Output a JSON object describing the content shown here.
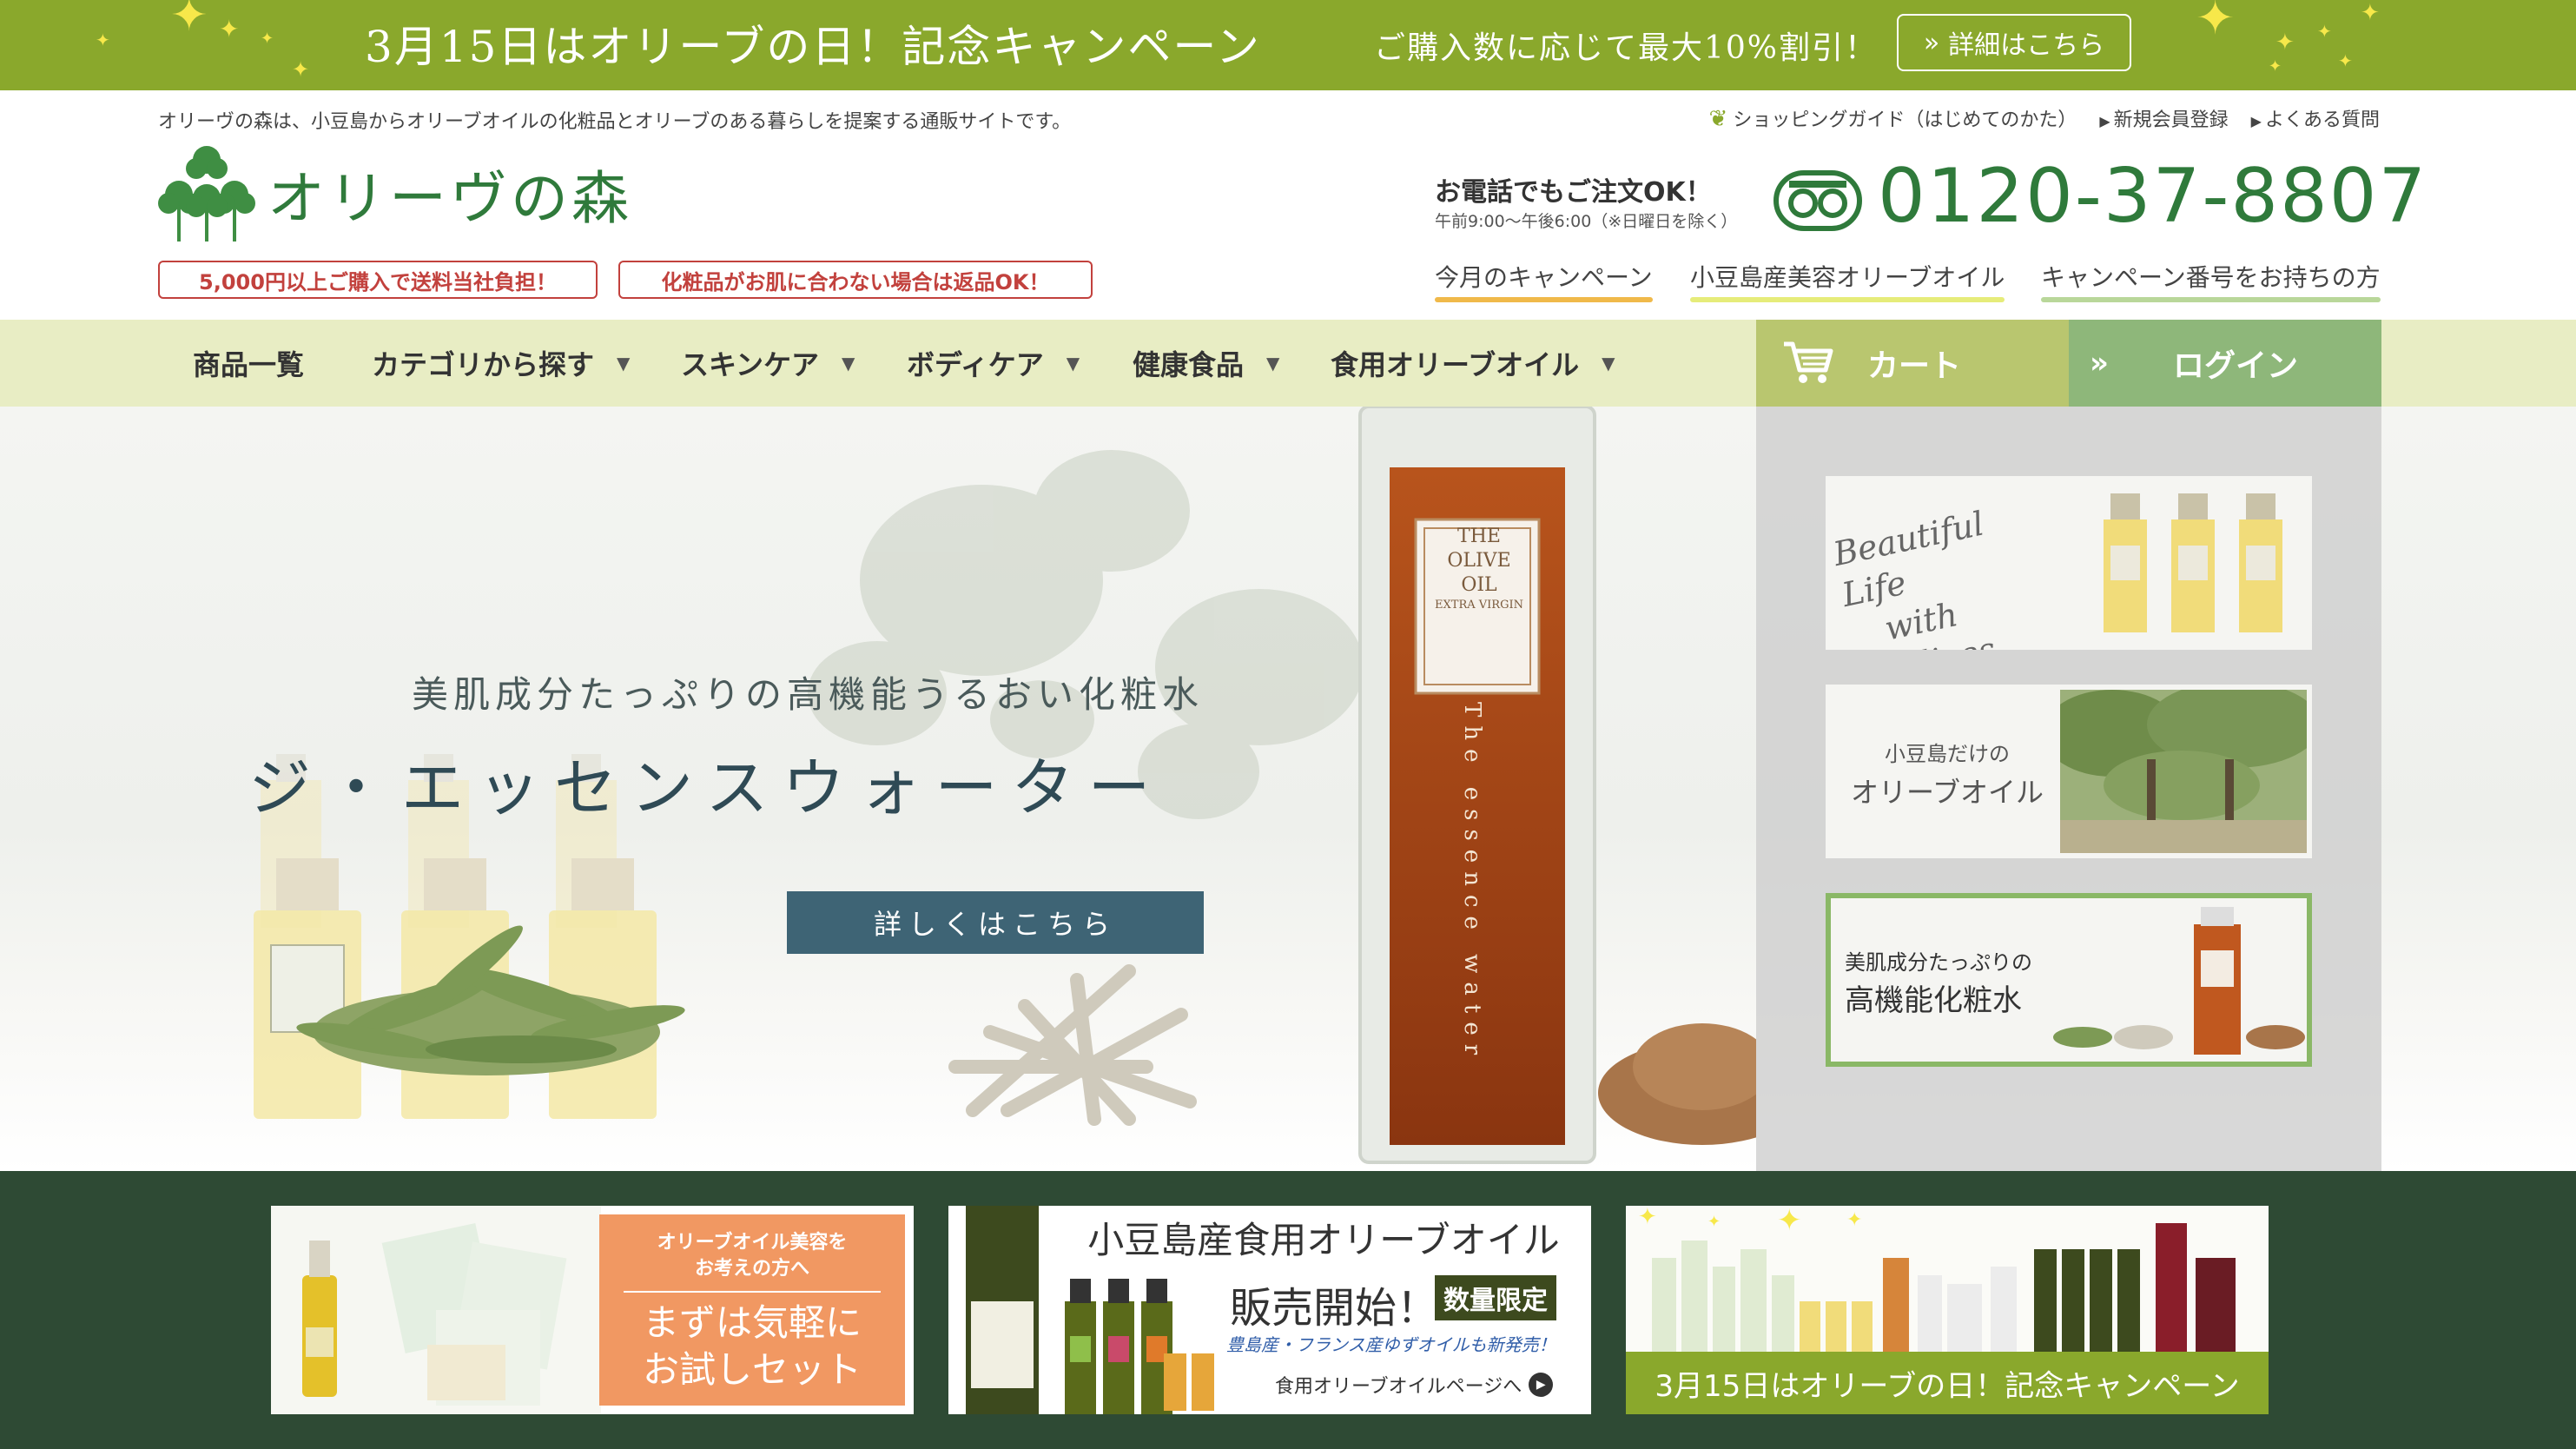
{
  "campaign_bar": {
    "title": "3月15日はオリーブの日！記念キャンペーン",
    "discount": "ご購入数に応じて最大10%割引！",
    "details_button": "詳細はこちら"
  },
  "header": {
    "intro": "オリーヴの森は、小豆島からオリーブオイルの化粧品とオリーブのある暮らしを提案する通販サイトです。",
    "utility_links": [
      "ショッピングガイド（はじめてのかた）",
      "新規会員登録",
      "よくある質問"
    ],
    "logo_text": "オリーヴの森",
    "badges": [
      "5,000円以上ご購入で送料当社負担！",
      "化粧品がお肌に合わない場合は返品OK！"
    ],
    "phone_note": "お電話でもご注文OK！",
    "phone_hours": "午前9:00～午後6:00（※日曜日を除く）",
    "phone_number": "0120-37-8807",
    "sub_links": [
      "今月のキャンペーン",
      "小豆島産美容オリーブオイル",
      "キャンペーン番号をお持ちの方"
    ]
  },
  "nav": {
    "items": [
      "商品一覧",
      "カテゴリから探す",
      "スキンケア",
      "ボディケア",
      "健康食品",
      "食用オリーブオイル"
    ],
    "cart": "カート",
    "login": "ログイン"
  },
  "hero": {
    "subtitle": "美肌成分たっぷりの高機能うるおい化粧水",
    "title": "ジ・エッセンスウォーター",
    "button": "詳しくはこちら",
    "bottle_label": [
      "THE",
      "OLIVE",
      "OIL",
      "EXTRA VIRGIN"
    ],
    "bottle_text": "The essence water",
    "side_cards": [
      {
        "lines": [
          "Beautiful Life",
          "with Olives"
        ]
      },
      {
        "lines": [
          "小豆島だけの",
          "オリーブオイル"
        ]
      },
      {
        "lines": [
          "美肌成分たっぷりの",
          "高機能化粧水"
        ]
      }
    ]
  },
  "banners": [
    {
      "head": [
        "オリーブオイル美容を",
        "お考えの方へ"
      ],
      "main": [
        "まずは気軽に",
        "お試しセット"
      ]
    },
    {
      "title": "小豆島産食用オリーブオイル",
      "sub": "販売開始！",
      "badge": "数量限定",
      "note": "豊島産・フランス産ゆずオイルも新発売！",
      "link": "食用オリーブオイルページへ"
    },
    {
      "caption": "3月15日はオリーブの日！記念キャンペーン"
    }
  ],
  "colors": {
    "brand_green": "#2f7a3b",
    "campaign_green": "#8aa82c",
    "nav_bg": "#e8edc4",
    "cart_bg": "#b9c66f",
    "login_bg": "#8eb77a",
    "badge_red": "#c2413d",
    "hero_button": "#3e6475",
    "footer_band": "#2e4a34"
  }
}
